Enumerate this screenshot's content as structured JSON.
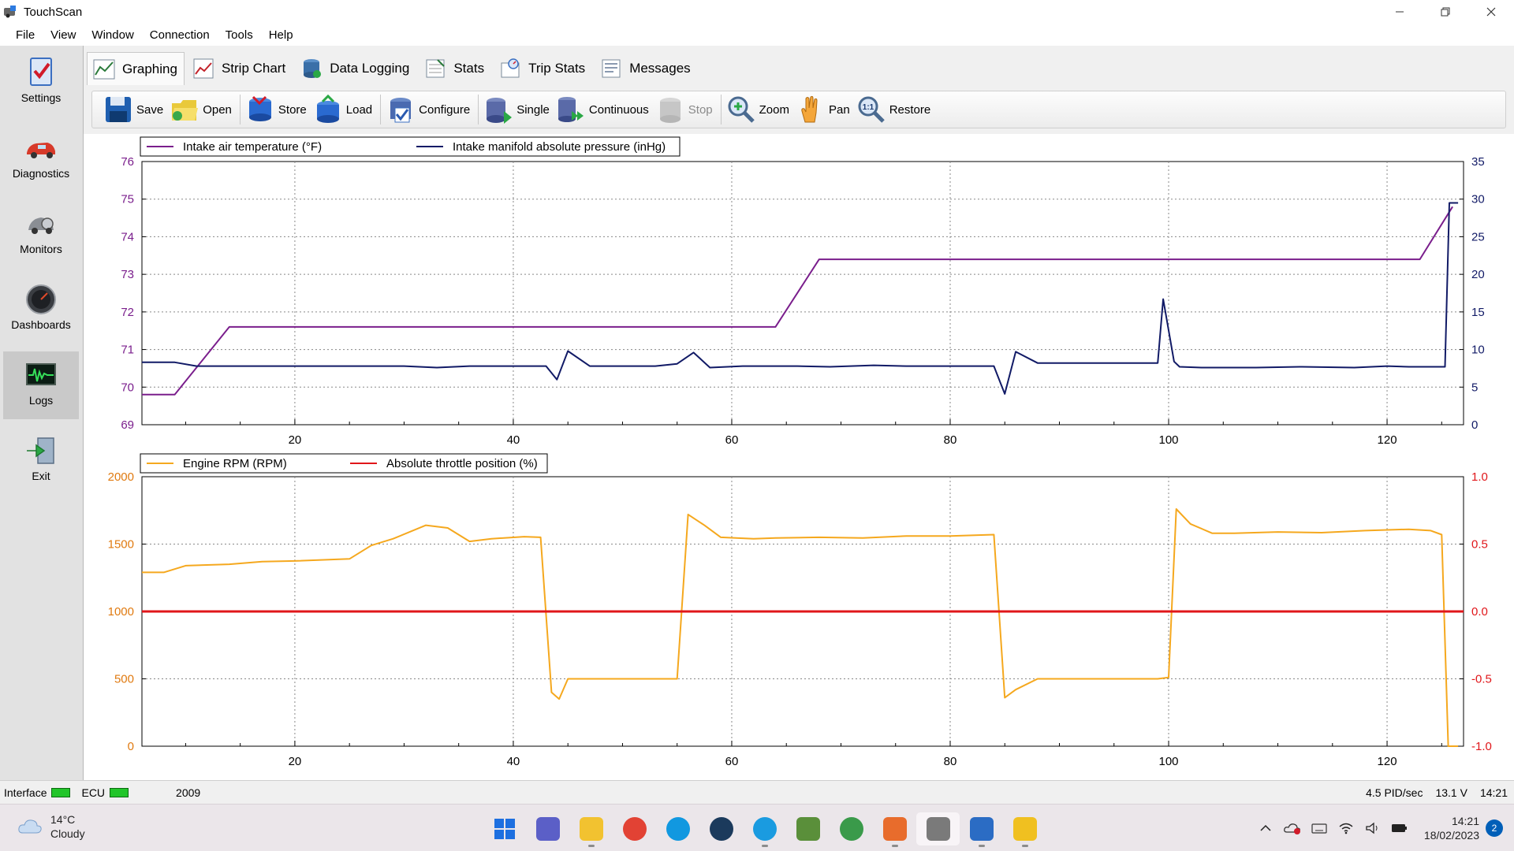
{
  "window": {
    "title": "TouchScan"
  },
  "menu": [
    "File",
    "View",
    "Window",
    "Connection",
    "Tools",
    "Help"
  ],
  "sidebar": [
    {
      "label": "Settings",
      "icon": "settings-checklist-icon"
    },
    {
      "label": "Diagnostics",
      "icon": "car-icon"
    },
    {
      "label": "Monitors",
      "icon": "monitor-gauge-icon"
    },
    {
      "label": "Dashboards",
      "icon": "speedometer-icon"
    },
    {
      "label": "Logs",
      "icon": "waveform-screen-icon",
      "active": true
    },
    {
      "label": "Exit",
      "icon": "exit-arrow-icon"
    }
  ],
  "tabs": [
    {
      "label": "Graphing",
      "active": true
    },
    {
      "label": "Strip Chart"
    },
    {
      "label": "Data Logging"
    },
    {
      "label": "Stats"
    },
    {
      "label": "Trip Stats"
    },
    {
      "label": "Messages"
    }
  ],
  "toolbar": [
    {
      "label": "Save",
      "icon": "save-disk-icon"
    },
    {
      "label": "Open",
      "icon": "open-folder-icon"
    },
    {
      "label": "Store",
      "icon": "store-database-icon"
    },
    {
      "label": "Load",
      "icon": "load-database-icon"
    },
    {
      "label": "Configure",
      "icon": "configure-icon"
    },
    {
      "label": "Single",
      "icon": "single-capture-icon"
    },
    {
      "label": "Continuous",
      "icon": "continuous-capture-icon"
    },
    {
      "label": "Stop",
      "icon": "stop-icon",
      "disabled": true
    },
    {
      "label": "Zoom",
      "icon": "zoom-icon"
    },
    {
      "label": "Pan",
      "icon": "hand-pan-icon"
    },
    {
      "label": "Restore",
      "icon": "restore-zoom-icon"
    }
  ],
  "chart_data": [
    {
      "type": "line",
      "xlim": [
        6,
        127
      ],
      "x_ticks": [
        20,
        40,
        60,
        80,
        100,
        120
      ],
      "grid": true,
      "legend_position": "top-left",
      "series": [
        {
          "name": "Intake air temperature (°F)",
          "color": "#7a1e8c",
          "axis": "left",
          "ylim": [
            69,
            76
          ],
          "y_ticks": [
            69,
            70,
            71,
            72,
            73,
            74,
            75,
            76
          ],
          "x": [
            6,
            9,
            14,
            64,
            68,
            123,
            126
          ],
          "y": [
            69.8,
            69.8,
            71.6,
            71.6,
            73.4,
            73.4,
            74.8
          ]
        },
        {
          "name": "Intake manifold absolute pressure (inHg)",
          "color": "#111a66",
          "axis": "right",
          "ylim": [
            0,
            35
          ],
          "y_ticks": [
            0,
            5,
            10,
            15,
            20,
            25,
            30,
            35
          ],
          "x": [
            6,
            9,
            11,
            13,
            30,
            33,
            36,
            43,
            44,
            45,
            47,
            53,
            55,
            56.5,
            58,
            61,
            66,
            69,
            73,
            76,
            84,
            85,
            86,
            88,
            90,
            99,
            99.5,
            100.5,
            101,
            103,
            108,
            112,
            117,
            120,
            122,
            124,
            125.3,
            125.7,
            126.5
          ],
          "y": [
            8.3,
            8.3,
            7.8,
            7.8,
            7.8,
            7.6,
            7.8,
            7.8,
            6.0,
            9.8,
            7.8,
            7.8,
            8.1,
            9.6,
            7.6,
            7.8,
            7.8,
            7.7,
            7.9,
            7.8,
            7.8,
            4.1,
            9.7,
            8.2,
            8.2,
            8.2,
            16.7,
            8.4,
            7.7,
            7.6,
            7.6,
            7.7,
            7.6,
            7.8,
            7.7,
            7.7,
            7.7,
            29.5,
            29.5
          ]
        }
      ]
    },
    {
      "type": "line",
      "xlim": [
        6,
        127
      ],
      "x_ticks": [
        20,
        40,
        60,
        80,
        100,
        120
      ],
      "grid": true,
      "legend_position": "top-left",
      "series": [
        {
          "name": "Engine RPM (RPM)",
          "color": "#f5a81e",
          "axis": "left",
          "ylim": [
            0,
            2000
          ],
          "y_ticks": [
            0,
            500,
            1000,
            1500,
            2000
          ],
          "x": [
            6,
            8,
            10,
            14,
            17,
            20,
            25,
            27,
            29,
            32,
            34,
            36,
            38,
            41,
            42.5,
            43.5,
            44.2,
            45,
            46,
            50,
            55,
            56,
            57.5,
            59,
            62,
            64,
            68,
            72,
            76,
            80,
            84,
            85,
            86,
            88,
            92,
            96,
            99,
            100,
            100.7,
            102,
            104,
            106,
            110,
            114,
            118,
            122,
            124,
            125,
            125.6,
            126.5
          ],
          "y": [
            1290,
            1290,
            1340,
            1350,
            1370,
            1375,
            1390,
            1490,
            1540,
            1640,
            1620,
            1520,
            1540,
            1555,
            1550,
            400,
            350,
            500,
            500,
            500,
            500,
            1720,
            1640,
            1550,
            1540,
            1545,
            1550,
            1545,
            1560,
            1560,
            1570,
            360,
            420,
            500,
            500,
            500,
            500,
            510,
            1760,
            1650,
            1580,
            1580,
            1590,
            1585,
            1600,
            1610,
            1600,
            1570,
            0,
            0
          ]
        },
        {
          "name": "Absolute throttle position (%)",
          "color": "#e0161a",
          "axis": "right",
          "ylim": [
            -1.0,
            1.0
          ],
          "y_ticks": [
            -1.0,
            -0.5,
            0.0,
            0.5,
            1.0
          ],
          "x": [
            6,
            127
          ],
          "y": [
            0.0,
            0.0
          ]
        }
      ]
    }
  ],
  "status": {
    "interface_label": "Interface",
    "ecu_label": "ECU",
    "year": "2009",
    "pid_rate": "4.5 PID/sec",
    "voltage": "13.1 V",
    "time": "14:21"
  },
  "taskbar": {
    "weather_temp": "14°C",
    "weather_desc": "Cloudy",
    "clock_time": "14:21",
    "clock_date": "18/02/2023",
    "notification_count": "2",
    "apps": [
      {
        "icon": "windows-start-icon",
        "color": "#1d6fe0"
      },
      {
        "icon": "teams-chat-icon",
        "color": "#5b5fc7"
      },
      {
        "icon": "file-explorer-icon",
        "color": "#f2c230",
        "open": true
      },
      {
        "icon": "chrome-icon",
        "color": "#e24234"
      },
      {
        "icon": "skype-icon",
        "color": "#1198e0"
      },
      {
        "icon": "steam-icon",
        "color": "#1b3a5c"
      },
      {
        "icon": "edge-icon",
        "color": "#1a9be0",
        "open": true
      },
      {
        "icon": "minecraft-icon",
        "color": "#5a8f3a"
      },
      {
        "icon": "edge-dev-icon",
        "color": "#3a9a4a"
      },
      {
        "icon": "maps-pin-icon",
        "color": "#e86c2c",
        "open": true
      },
      {
        "icon": "touchscan-icon",
        "color": "#7a7a7a",
        "active": true
      },
      {
        "icon": "notepad-icon",
        "color": "#2b6cc4",
        "open": true
      },
      {
        "icon": "notes-help-icon",
        "color": "#f0c020",
        "open": true
      }
    ]
  }
}
